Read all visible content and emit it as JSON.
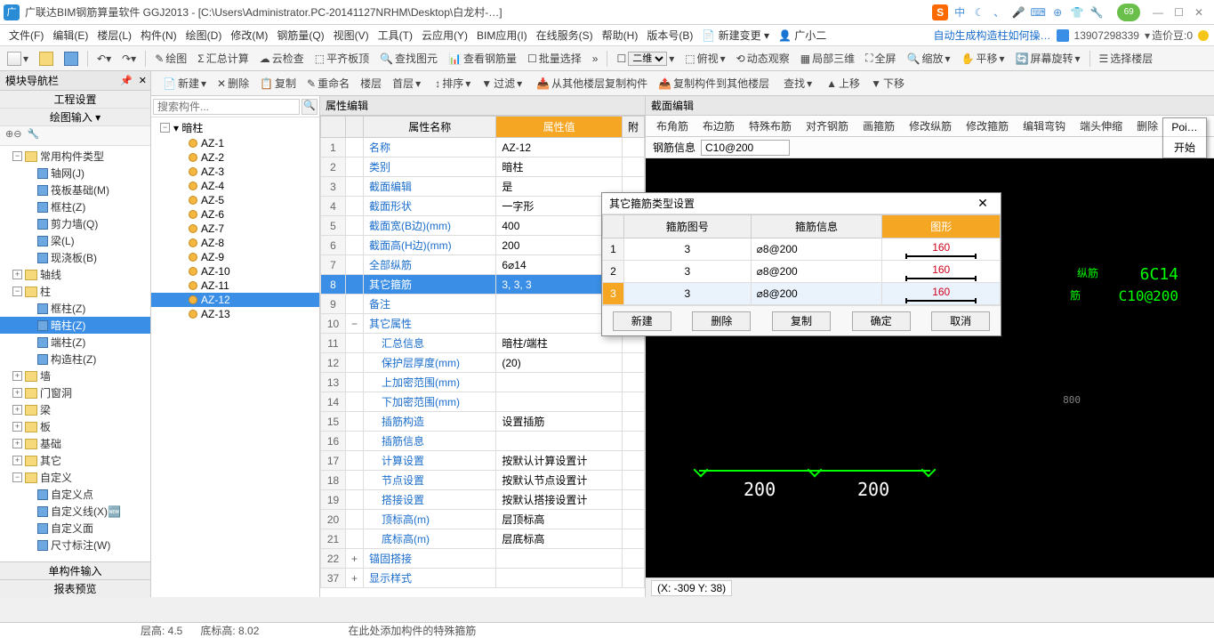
{
  "window": {
    "title": "广联达BIM钢筋算量软件 GGJ2013 - [C:\\Users\\Administrator.PC-20141127NRHM\\Desktop\\白龙村-…]",
    "ime": [
      "中",
      "☾",
      "、",
      "🎤",
      "⌨",
      "⊕",
      "👕",
      "🔧"
    ],
    "green_badge": "69"
  },
  "menu": {
    "items": [
      "文件(F)",
      "编辑(E)",
      "楼层(L)",
      "构件(N)",
      "绘图(D)",
      "修改(M)",
      "钢筋量(Q)",
      "视图(V)",
      "工具(T)",
      "云应用(Y)",
      "BIM应用(I)",
      "在线服务(S)",
      "帮助(H)",
      "版本号(B)"
    ],
    "new_change": "新建变更",
    "user_small": "广小二",
    "blue_link": "自动生成构造柱如何操…",
    "phone": "13907298339",
    "coin_label": "造价豆:0"
  },
  "toolbar1": {
    "items": [
      "绘图",
      "汇总计算",
      "云检查",
      "平齐板顶",
      "查找图元",
      "查看钢筋量",
      "批量选择"
    ],
    "view_mode": "二维",
    "right_items": [
      "俯视",
      "动态观察",
      "局部三维",
      "全屏",
      "缩放",
      "平移",
      "屏幕旋转",
      "选择楼层"
    ]
  },
  "toolbar2": {
    "items": [
      "新建",
      "删除",
      "复制",
      "重命名",
      "楼层",
      "首层",
      "排序",
      "过滤",
      "从其他楼层复制构件",
      "复制构件到其他楼层",
      "查找",
      "上移",
      "下移"
    ]
  },
  "nav_panel": {
    "title": "模块导航栏",
    "sub1": "工程设置",
    "sub2": "绘图输入",
    "tree": [
      {
        "l": 1,
        "exp": "-",
        "icon": "folder",
        "label": "常用构件类型"
      },
      {
        "l": 2,
        "icon": "c",
        "label": "轴网(J)"
      },
      {
        "l": 2,
        "icon": "c",
        "label": "筏板基础(M)"
      },
      {
        "l": 2,
        "icon": "c",
        "label": "框柱(Z)"
      },
      {
        "l": 2,
        "icon": "c",
        "label": "剪力墙(Q)"
      },
      {
        "l": 2,
        "icon": "c",
        "label": "梁(L)"
      },
      {
        "l": 2,
        "icon": "c",
        "label": "现浇板(B)"
      },
      {
        "l": 1,
        "exp": "+",
        "icon": "folder",
        "label": "轴线"
      },
      {
        "l": 1,
        "exp": "-",
        "icon": "folder",
        "label": "柱"
      },
      {
        "l": 2,
        "icon": "c",
        "label": "框柱(Z)"
      },
      {
        "l": 2,
        "icon": "c",
        "label": "暗柱(Z)",
        "sel": true
      },
      {
        "l": 2,
        "icon": "c",
        "label": "端柱(Z)"
      },
      {
        "l": 2,
        "icon": "c",
        "label": "构造柱(Z)"
      },
      {
        "l": 1,
        "exp": "+",
        "icon": "folder",
        "label": "墙"
      },
      {
        "l": 1,
        "exp": "+",
        "icon": "folder",
        "label": "门窗洞"
      },
      {
        "l": 1,
        "exp": "+",
        "icon": "folder",
        "label": "梁"
      },
      {
        "l": 1,
        "exp": "+",
        "icon": "folder",
        "label": "板"
      },
      {
        "l": 1,
        "exp": "+",
        "icon": "folder",
        "label": "基础"
      },
      {
        "l": 1,
        "exp": "+",
        "icon": "folder",
        "label": "其它"
      },
      {
        "l": 1,
        "exp": "-",
        "icon": "folder",
        "label": "自定义"
      },
      {
        "l": 2,
        "icon": "c",
        "label": "自定义点"
      },
      {
        "l": 2,
        "icon": "c",
        "label": "自定义线(X)🆕"
      },
      {
        "l": 2,
        "icon": "c",
        "label": "自定义面"
      },
      {
        "l": 2,
        "icon": "c",
        "label": "尺寸标注(W)"
      }
    ],
    "bottom_tabs": [
      "单构件输入",
      "报表预览"
    ]
  },
  "comp_panel": {
    "search_placeholder": "搜索构件...",
    "root": "暗柱",
    "items": [
      "AZ-1",
      "AZ-2",
      "AZ-3",
      "AZ-4",
      "AZ-5",
      "AZ-6",
      "AZ-7",
      "AZ-8",
      "AZ-9",
      "AZ-10",
      "AZ-11",
      "AZ-12",
      "AZ-13"
    ],
    "selected": "AZ-12"
  },
  "prop_panel": {
    "title": "属性编辑",
    "head_name": "属性名称",
    "head_value": "属性值",
    "head_attach": "附",
    "rows": [
      {
        "n": "1",
        "name": "名称",
        "val": "AZ-12"
      },
      {
        "n": "2",
        "name": "类别",
        "val": "暗柱"
      },
      {
        "n": "3",
        "name": "截面编辑",
        "val": "是"
      },
      {
        "n": "4",
        "name": "截面形状",
        "val": "一字形"
      },
      {
        "n": "5",
        "name": "截面宽(B边)(mm)",
        "val": "400"
      },
      {
        "n": "6",
        "name": "截面高(H边)(mm)",
        "val": "200"
      },
      {
        "n": "7",
        "name": "全部纵筋",
        "val": "6⌀14"
      },
      {
        "n": "8",
        "name": "其它箍筋",
        "val": "3, 3, 3",
        "sel": true
      },
      {
        "n": "9",
        "name": "备注",
        "val": ""
      },
      {
        "n": "10",
        "name": "其它属性",
        "val": "",
        "exp": "-"
      },
      {
        "n": "11",
        "name": "汇总信息",
        "val": "暗柱/端柱",
        "indent": true
      },
      {
        "n": "12",
        "name": "保护层厚度(mm)",
        "val": "(20)",
        "indent": true
      },
      {
        "n": "13",
        "name": "上加密范围(mm)",
        "val": "",
        "indent": true
      },
      {
        "n": "14",
        "name": "下加密范围(mm)",
        "val": "",
        "indent": true
      },
      {
        "n": "15",
        "name": "插筋构造",
        "val": "设置插筋",
        "indent": true
      },
      {
        "n": "16",
        "name": "插筋信息",
        "val": "",
        "indent": true
      },
      {
        "n": "17",
        "name": "计算设置",
        "val": "按默认计算设置计",
        "indent": true
      },
      {
        "n": "18",
        "name": "节点设置",
        "val": "按默认节点设置计",
        "indent": true
      },
      {
        "n": "19",
        "name": "搭接设置",
        "val": "按默认搭接设置计",
        "indent": true
      },
      {
        "n": "20",
        "name": "顶标高(m)",
        "val": "层顶标高",
        "indent": true
      },
      {
        "n": "21",
        "name": "底标高(m)",
        "val": "层底标高",
        "indent": true
      },
      {
        "n": "22",
        "name": "锚固搭接",
        "val": "",
        "exp": "+"
      },
      {
        "n": "37",
        "name": "显示样式",
        "val": "",
        "exp": "+"
      }
    ]
  },
  "right_area": {
    "title": "截面编辑",
    "tabs": [
      "布角筋",
      "布边筋",
      "特殊布筋",
      "对齐钢筋",
      "画箍筋",
      "修改纵筋",
      "修改箍筋",
      "编辑弯钩",
      "端头伸缩",
      "删除"
    ],
    "rebar_label": "钢筋信息",
    "rebar_value": "C10@200",
    "vp_label1": "纵筋",
    "vp_val1": "6C14",
    "vp_label2": "筋",
    "vp_val2": "C10@200",
    "vp_dim": "200",
    "vp_side": "800",
    "coord": "(X: -309 Y: 38)"
  },
  "start_box": {
    "line1": "Poi…",
    "line2": "开始"
  },
  "modal": {
    "title": "其它箍筋类型设置",
    "head_num": "箍筋图号",
    "head_info": "箍筋信息",
    "head_graph": "图形",
    "rows": [
      {
        "n": "1",
        "num": "3",
        "info": "⌀8@200",
        "g": "160"
      },
      {
        "n": "2",
        "num": "3",
        "info": "⌀8@200",
        "g": "160"
      },
      {
        "n": "3",
        "num": "3",
        "info": "⌀8@200",
        "g": "160",
        "sel": true
      }
    ],
    "btn_new": "新建",
    "btn_del": "删除",
    "btn_copy": "复制",
    "btn_ok": "确定",
    "btn_cancel": "取消"
  },
  "bottom_status": {
    "left1": "层高: 4.5",
    "left2": "底标高: 8.02",
    "mid": "在此处添加构件的特殊箍筋"
  }
}
